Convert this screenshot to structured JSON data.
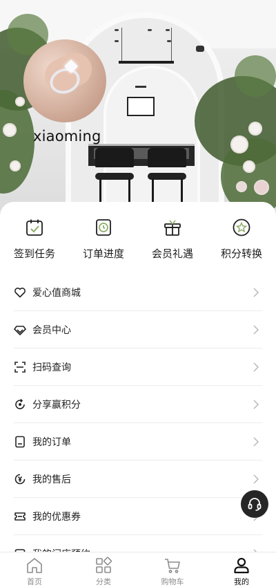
{
  "profile": {
    "username": "xiaoming"
  },
  "quick_actions": [
    {
      "label": "签到任务",
      "icon": "calendar-check-icon"
    },
    {
      "label": "订单进度",
      "icon": "clock-document-icon"
    },
    {
      "label": "会员礼遇",
      "icon": "gift-box-icon"
    },
    {
      "label": "积分转换",
      "icon": "star-circle-icon"
    }
  ],
  "menu": [
    {
      "label": "爱心值商城",
      "icon": "heart-icon"
    },
    {
      "label": "会员中心",
      "icon": "diamond-icon"
    },
    {
      "label": "扫码查询",
      "icon": "scan-icon"
    },
    {
      "label": "分享赢积分",
      "icon": "share-refresh-icon"
    },
    {
      "label": "我的订单",
      "icon": "order-document-icon"
    },
    {
      "label": "我的售后",
      "icon": "yen-service-icon"
    },
    {
      "label": "我的优惠券",
      "icon": "coupon-icon"
    },
    {
      "label": "我的门店预约",
      "icon": "store-appointment-icon"
    }
  ],
  "tabbar": [
    {
      "label": "首页",
      "icon": "home-icon",
      "active": false
    },
    {
      "label": "分类",
      "icon": "category-grid-icon",
      "active": false
    },
    {
      "label": "购物车",
      "icon": "cart-icon",
      "active": false
    },
    {
      "label": "我的",
      "icon": "user-icon",
      "active": true
    }
  ],
  "colors": {
    "text": "#222222",
    "active_tab": "#111111",
    "inactive_tab": "#8c8c8c",
    "accent_green": "#8fae6b",
    "floating_button": "#262626"
  }
}
